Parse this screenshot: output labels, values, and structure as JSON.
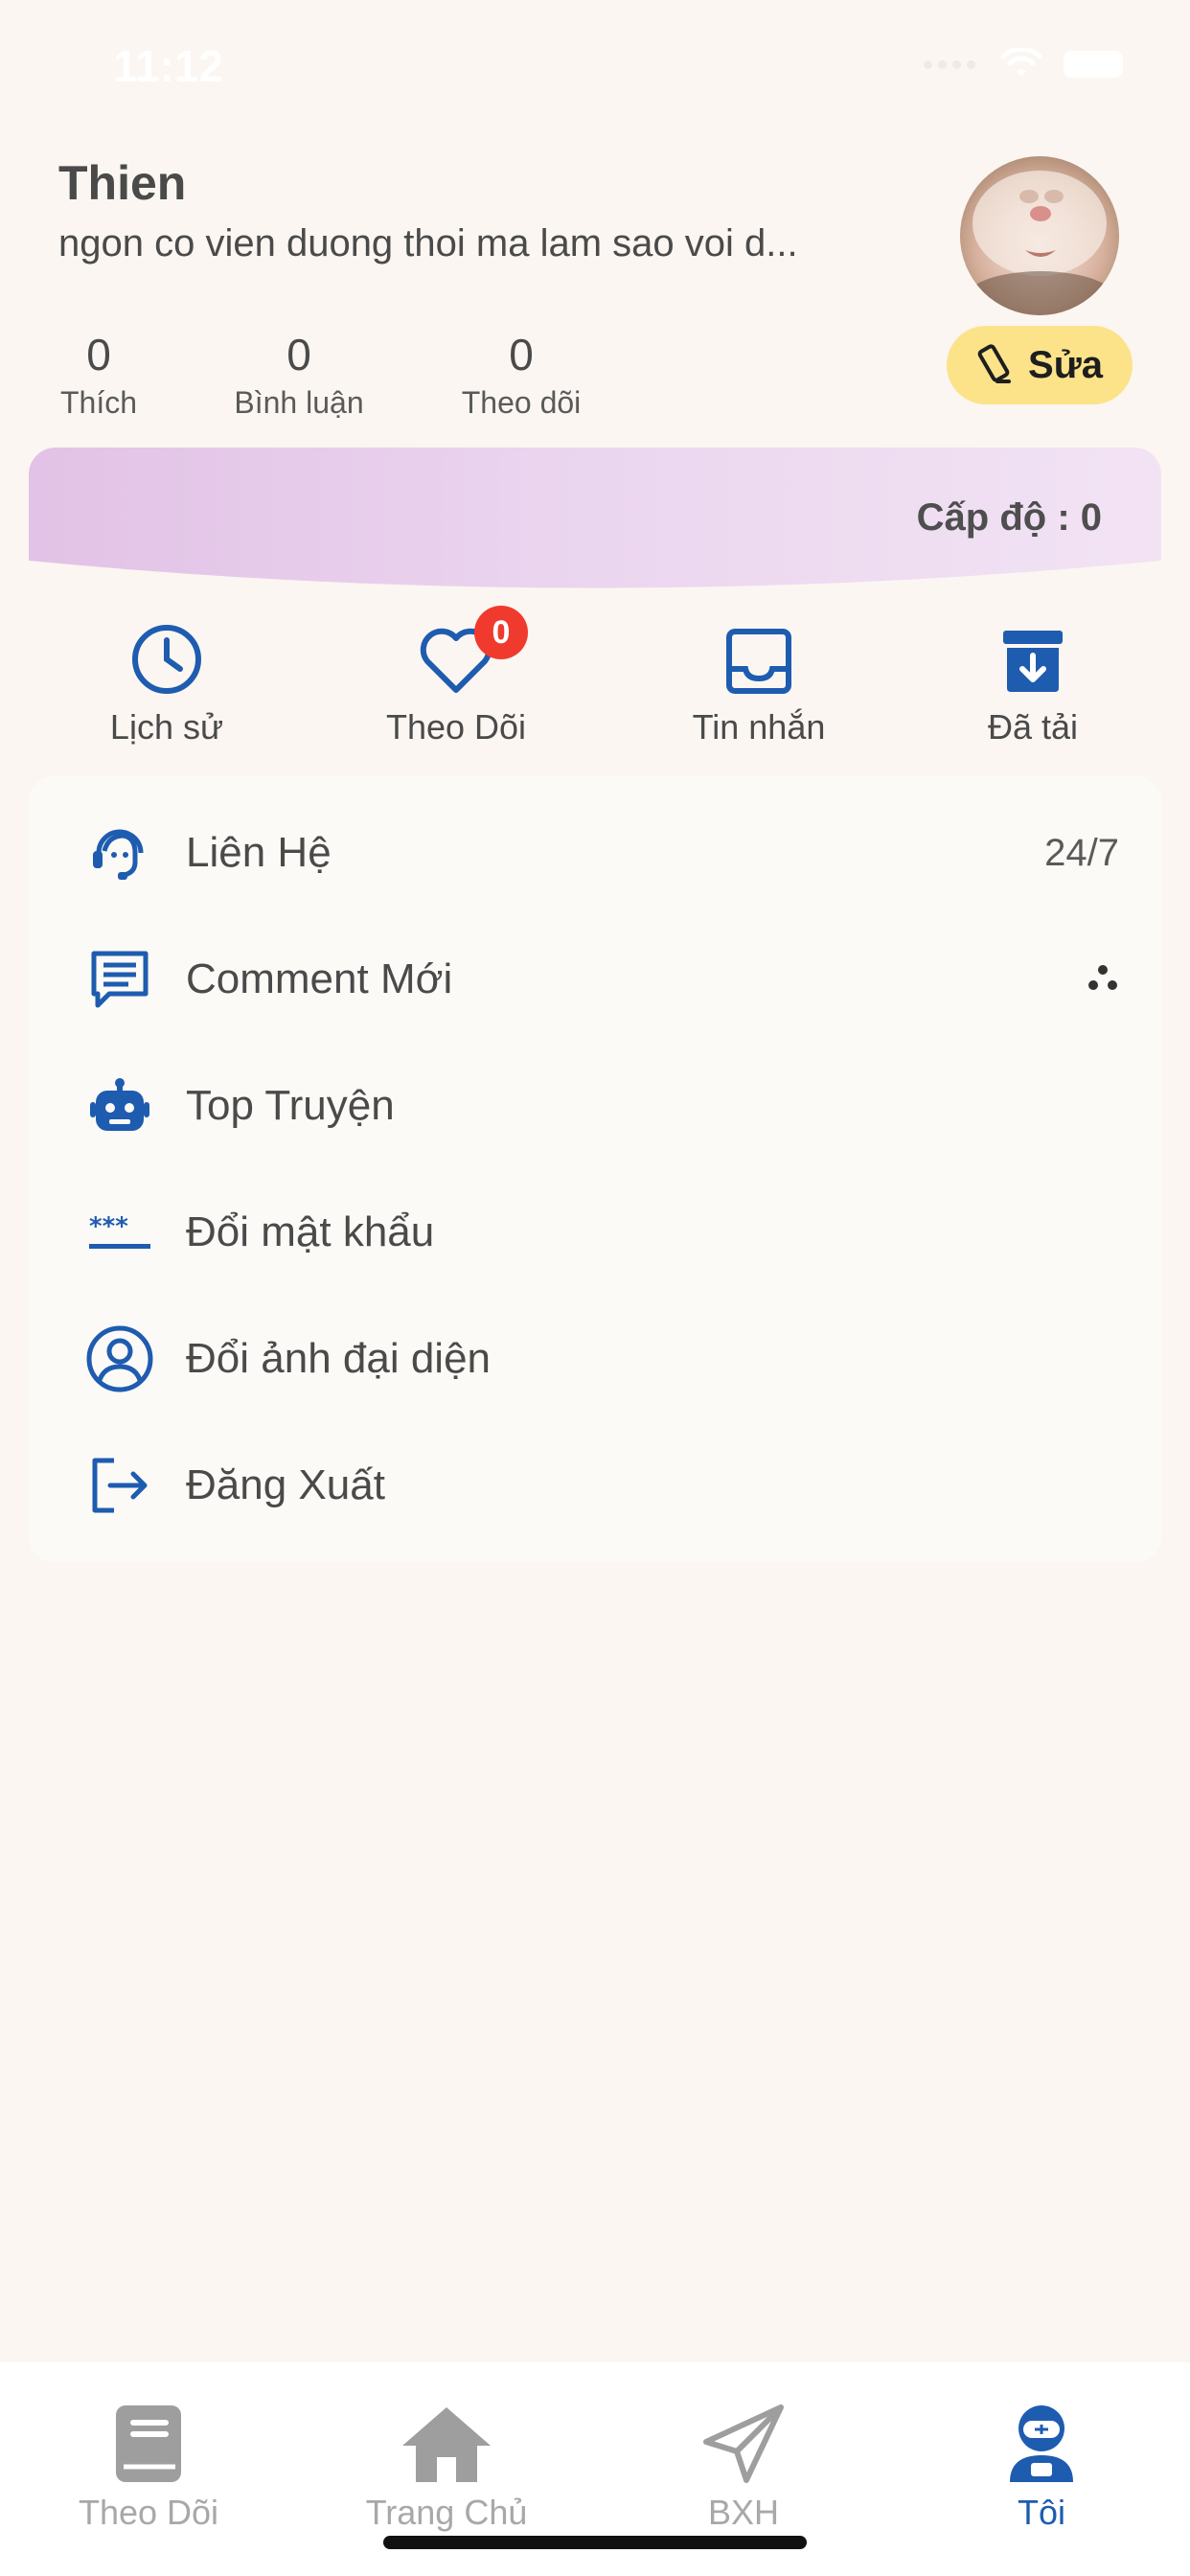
{
  "status_bar": {
    "time": "11:12"
  },
  "profile": {
    "name": "Thien",
    "bio": "ngon co vien duong thoi ma lam sao voi d...",
    "edit_label": "Sửa",
    "stats": [
      {
        "value": "0",
        "label": "Thích"
      },
      {
        "value": "0",
        "label": "Bình luận"
      },
      {
        "value": "0",
        "label": "Theo dõi"
      }
    ]
  },
  "level": {
    "label": "Cấp độ : 0"
  },
  "quick_actions": [
    {
      "label": "Lịch sử",
      "icon": "clock-icon"
    },
    {
      "label": "Theo Dõi",
      "icon": "heart-icon",
      "badge": "0"
    },
    {
      "label": "Tin nhắn",
      "icon": "inbox-icon"
    },
    {
      "label": "Đã tải",
      "icon": "download-box-icon"
    }
  ],
  "menu": [
    {
      "label": "Liên Hệ",
      "icon": "support-agent-icon",
      "right": "24/7"
    },
    {
      "label": "Comment Mới",
      "icon": "comment-icon",
      "right_icon": "dots-icon"
    },
    {
      "label": "Top Truyện",
      "icon": "robot-icon"
    },
    {
      "label": "Đổi mật khẩu",
      "icon": "password-icon"
    },
    {
      "label": "Đổi ảnh đại diện",
      "icon": "user-circle-icon"
    },
    {
      "label": "Đăng Xuất",
      "icon": "logout-icon"
    }
  ],
  "tabs": [
    {
      "label": "Theo Dõi",
      "icon": "book-icon",
      "active": false
    },
    {
      "label": "Trang Chủ",
      "icon": "home-icon",
      "active": false
    },
    {
      "label": "BXH",
      "icon": "paper-plane-icon",
      "active": false
    },
    {
      "label": "Tôi",
      "icon": "astronaut-icon",
      "active": true
    }
  ],
  "colors": {
    "background": "#FBF6F1",
    "accent_blue": "#1E5CB0",
    "edit_button": "#FCE38A",
    "badge_red": "#F03A2E",
    "level_banner": "#E2C2E6"
  }
}
